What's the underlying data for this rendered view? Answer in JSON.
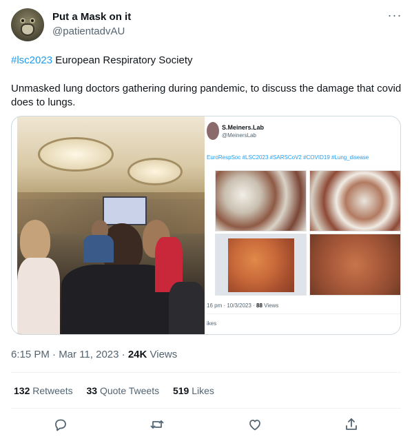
{
  "author": {
    "display_name": "Put a Mask on it",
    "handle": "@patientadvAU"
  },
  "tweet": {
    "hashtag": "#lsc2023",
    "hashtag_suffix": " European Respiratory Society",
    "text": "Unmasked lung doctors gathering during pandemic, to discuss the damage that covid does to lungs."
  },
  "embedded_post": {
    "name": "S.Meiners.Lab",
    "handle": "@MeinersLab",
    "tags": "EuroRespSoc #LSC2023 #SARSCoV2 #COVID19 #Lung_disease",
    "meta_prefix": "16 pm · 10/3/2023 · ",
    "views_count": "88",
    "views_label": " Views",
    "likes_label": "ikes"
  },
  "meta": {
    "time": "6:15 PM · Mar 11, 2023 · ",
    "views_count": "24K",
    "views_label": " Views"
  },
  "stats": {
    "retweets_count": "132",
    "retweets_label": " Retweets",
    "quotes_count": "33",
    "quotes_label": " Quote Tweets",
    "likes_count": "519",
    "likes_label": " Likes"
  },
  "icons": [
    "more-icon",
    "reply-icon",
    "retweet-icon",
    "like-icon",
    "share-icon"
  ],
  "colors": {
    "accent": "#1d9bf0",
    "secondary_text": "#536471",
    "primary_text": "#0f1419",
    "divider": "#eff3f4"
  }
}
